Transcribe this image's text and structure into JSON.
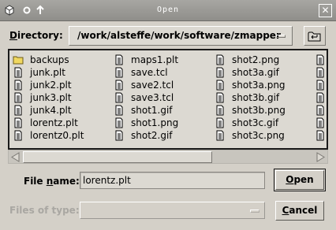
{
  "window": {
    "title": "Open",
    "close_glyph": "✕"
  },
  "directory": {
    "label_prefix": "",
    "label_underlined": "D",
    "label_rest": "irectory:",
    "path": "/work/alsteffe/work/software/zmapper"
  },
  "file_list": {
    "columns": [
      [
        {
          "name": "backups",
          "icon": "folder-icon"
        },
        {
          "name": "junk.plt",
          "icon": "file-icon"
        },
        {
          "name": "junk2.plt",
          "icon": "file-icon"
        },
        {
          "name": "junk3.plt",
          "icon": "file-icon"
        },
        {
          "name": "junk4.plt",
          "icon": "file-icon"
        },
        {
          "name": "lorentz.plt",
          "icon": "file-icon"
        },
        {
          "name": "lorentz0.plt",
          "icon": "file-icon"
        }
      ],
      [
        {
          "name": "maps1.plt",
          "icon": "file-icon"
        },
        {
          "name": "save.tcl",
          "icon": "file-icon"
        },
        {
          "name": "save2.tcl",
          "icon": "file-icon"
        },
        {
          "name": "save3.tcl",
          "icon": "file-icon"
        },
        {
          "name": "shot1.gif",
          "icon": "file-icon"
        },
        {
          "name": "shot1.png",
          "icon": "file-icon"
        },
        {
          "name": "shot2.gif",
          "icon": "file-icon"
        }
      ],
      [
        {
          "name": "shot2.png",
          "icon": "file-icon"
        },
        {
          "name": "shot3a.gif",
          "icon": "file-icon"
        },
        {
          "name": "shot3a.png",
          "icon": "file-icon"
        },
        {
          "name": "shot3b.gif",
          "icon": "file-icon"
        },
        {
          "name": "shot3b.png",
          "icon": "file-icon"
        },
        {
          "name": "shot3c.gif",
          "icon": "file-icon"
        },
        {
          "name": "shot3c.png",
          "icon": "file-icon"
        }
      ],
      [
        {
          "name": "",
          "icon": "file-icon"
        },
        {
          "name": "",
          "icon": "file-icon"
        },
        {
          "name": "",
          "icon": "file-icon"
        },
        {
          "name": "",
          "icon": "file-icon"
        },
        {
          "name": "",
          "icon": "file-icon"
        },
        {
          "name": "",
          "icon": "file-icon"
        },
        {
          "name": "",
          "icon": "file-icon"
        }
      ]
    ]
  },
  "file_name": {
    "label_prefix": "File ",
    "label_underlined": "n",
    "label_rest": "ame:",
    "value": "lorentz.plt"
  },
  "file_type": {
    "label": "Files of type:",
    "value": ""
  },
  "buttons": {
    "open_underlined": "O",
    "open_rest": "pen",
    "cancel_underlined": "C",
    "cancel_rest": "ancel"
  },
  "colors": {
    "background": "#d4d0c8",
    "titlebar": "#9a9995",
    "folder": "#f0d860"
  }
}
